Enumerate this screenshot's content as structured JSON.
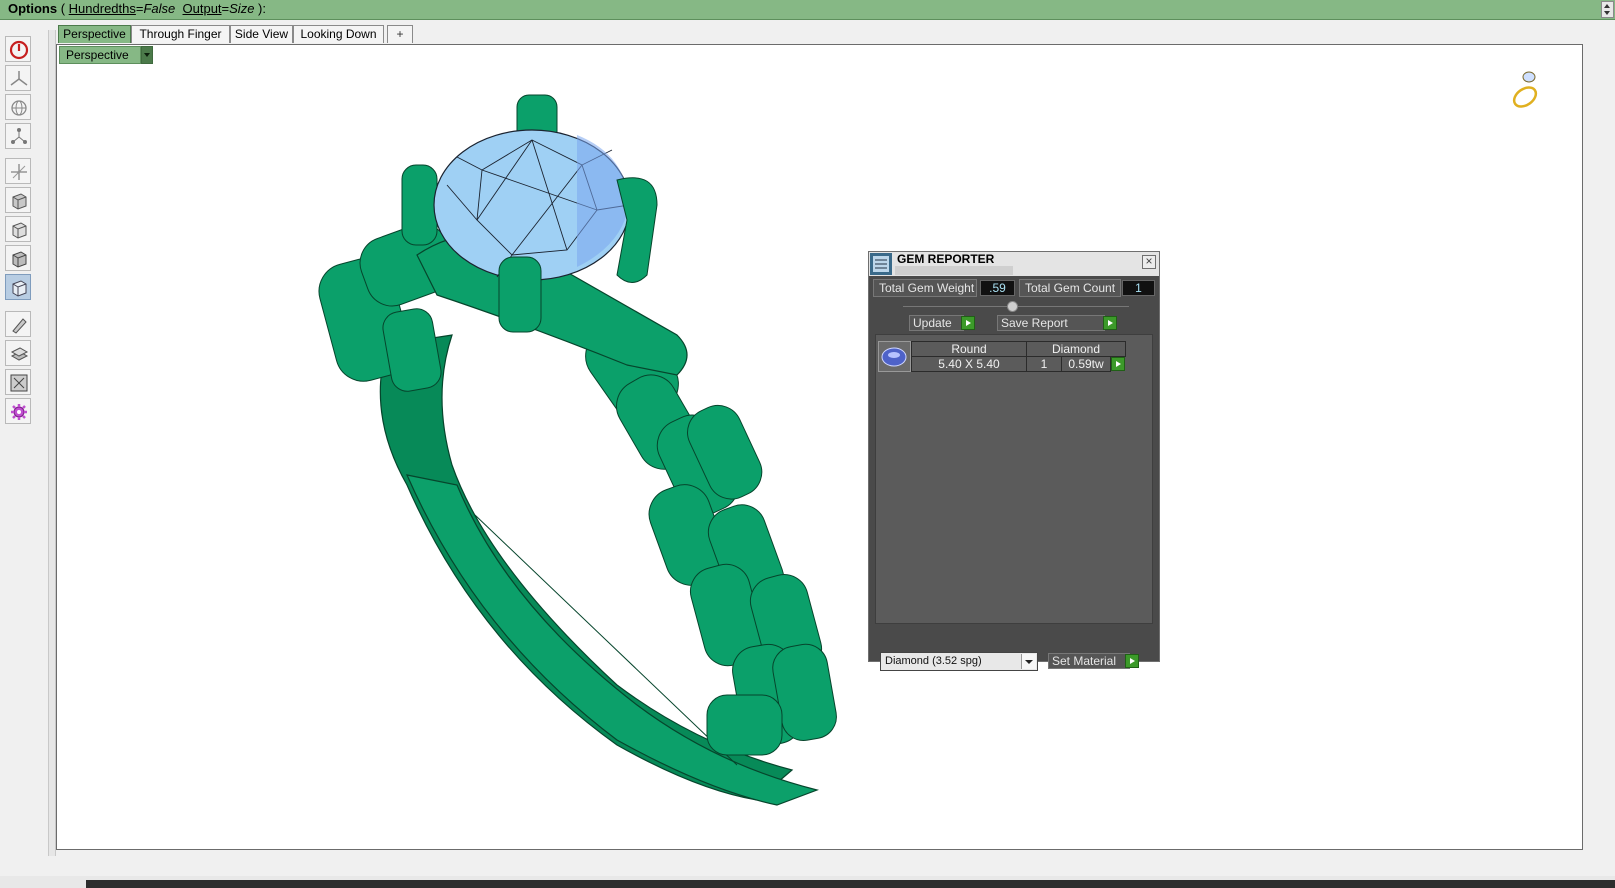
{
  "command_bar": {
    "lead": "Options",
    "open": " ( ",
    "opt1_key": "Hundredths",
    "eq1": "=",
    "opt1_val": "False",
    "opt2_key": "Output",
    "eq2": "=",
    "opt2_val": "Size",
    "close": " ):",
    "background": "#86b885"
  },
  "toolbar": {
    "tools": [
      {
        "name": "power-icon"
      },
      {
        "name": "view-axes-icon"
      },
      {
        "name": "globe-icon"
      },
      {
        "name": "nodes-icon"
      },
      {
        "name": "move-axes-icon"
      },
      {
        "name": "cube-shaded-icon"
      },
      {
        "name": "cube-wire-icon"
      },
      {
        "name": "cube-render-icon"
      },
      {
        "name": "cube-active-icon",
        "active": true
      },
      {
        "name": "pen-tool-icon"
      },
      {
        "name": "layers-icon"
      },
      {
        "name": "frame-icon"
      },
      {
        "name": "gear-plugin-icon"
      }
    ]
  },
  "tabs": {
    "items": [
      "Perspective",
      "Through Finger",
      "Side View",
      "Looking Down"
    ],
    "add_icon": "+",
    "active_index": 0
  },
  "viewport": {
    "label": "Perspective",
    "model_color": "#0a9a6a",
    "gem_color": "#9fd0f4"
  },
  "gem_reporter": {
    "title": "GEM REPORTER",
    "close": "×",
    "total_weight_label": "Total Gem Weight",
    "total_weight_value": ".59",
    "total_count_label": "Total Gem Count",
    "total_count_value": "1",
    "update_label": "Update",
    "save_report_label": "Save Report",
    "gems": [
      {
        "shape": "Round",
        "size": "5.40 X 5.40",
        "material": "Diamond",
        "count": "1",
        "weight": "0.59tw"
      }
    ],
    "material_select": "Diamond     (3.52 spg)",
    "set_material_label": "Set Material",
    "accent": "#3c9a2a"
  }
}
